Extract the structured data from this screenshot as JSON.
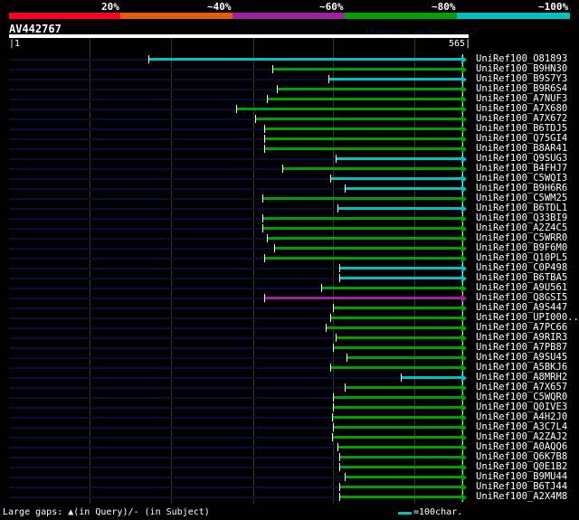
{
  "legend_scale": {
    "labels": [
      "20%",
      "~40%",
      "~60%",
      "~80%",
      "~100%"
    ],
    "colors": [
      "#ff0022",
      "#e06000",
      "#a020a0",
      "#00a000",
      "#00c0c0"
    ]
  },
  "query": {
    "name": "AV442767",
    "start": "1",
    "end": "565",
    "length": 565
  },
  "watermark": "AlignView.pm Beta rel.7",
  "hits": [
    {
      "name": "UniRef100_O81893",
      "start": 174,
      "color": "#00c0c0"
    },
    {
      "name": "UniRef100_B9HN30",
      "start": 329,
      "color": "#00a000"
    },
    {
      "name": "UniRef100_B9S7Y3",
      "start": 398,
      "color": "#00c0c0"
    },
    {
      "name": "UniRef100_B9R6S4",
      "start": 334,
      "color": "#00a000"
    },
    {
      "name": "UniRef100_A7NUF3",
      "start": 322,
      "color": "#00a000"
    },
    {
      "name": "UniRef100_A7X680",
      "start": 283,
      "color": "#00a000"
    },
    {
      "name": "UniRef100_A7X672",
      "start": 307,
      "color": "#00a000"
    },
    {
      "name": "UniRef100_B6TDJ5",
      "start": 319,
      "color": "#00a000"
    },
    {
      "name": "UniRef100_Q75GI4",
      "start": 319,
      "color": "#00a000"
    },
    {
      "name": "UniRef100_B8AR41",
      "start": 319,
      "color": "#00a000"
    },
    {
      "name": "UniRef100_Q9SUG3",
      "start": 407,
      "color": "#00c0c0"
    },
    {
      "name": "UniRef100_B4FHJ7",
      "start": 341,
      "color": "#00a000"
    },
    {
      "name": "UniRef100_C5WQI3",
      "start": 401,
      "color": "#00c0c0"
    },
    {
      "name": "UniRef100_B9H6R6",
      "start": 419,
      "color": "#00c0c0"
    },
    {
      "name": "UniRef100_C5WM25",
      "start": 316,
      "color": "#00a000"
    },
    {
      "name": "UniRef100_B6TDL1",
      "start": 410,
      "color": "#00c0c0"
    },
    {
      "name": "UniRef100_Q33BI9",
      "start": 316,
      "color": "#00a000"
    },
    {
      "name": "UniRef100_A2Z4C5",
      "start": 316,
      "color": "#00a000"
    },
    {
      "name": "UniRef100_C5WRR0",
      "start": 322,
      "color": "#00a000"
    },
    {
      "name": "UniRef100_B9F6M0",
      "start": 331,
      "color": "#00a000"
    },
    {
      "name": "UniRef100_Q10PL5",
      "start": 319,
      "color": "#00a000"
    },
    {
      "name": "UniRef100_C0P498",
      "start": 412,
      "color": "#00c0c0"
    },
    {
      "name": "UniRef100_B6TBA5",
      "start": 412,
      "color": "#00c0c0"
    },
    {
      "name": "UniRef100_A9U561",
      "start": 389,
      "color": "#00a000"
    },
    {
      "name": "UniRef100_Q8GSI5",
      "start": 319,
      "color": "#a020a0"
    },
    {
      "name": "UniRef100_A9S447",
      "start": 404,
      "color": "#00a000"
    },
    {
      "name": "UniRef100_UPI000..",
      "start": 401,
      "color": "#00a000"
    },
    {
      "name": "UniRef100_A7PC66",
      "start": 395,
      "color": "#00a000"
    },
    {
      "name": "UniRef100_A9RIR3",
      "start": 407,
      "color": "#00a000"
    },
    {
      "name": "UniRef100_A7PB87",
      "start": 404,
      "color": "#00a000"
    },
    {
      "name": "UniRef100_A9SU45",
      "start": 421,
      "color": "#00a000"
    },
    {
      "name": "UniRef100_A5BKJ6",
      "start": 401,
      "color": "#00a000"
    },
    {
      "name": "UniRef100_A8MRH2",
      "start": 489,
      "color": "#00c0c0"
    },
    {
      "name": "UniRef100_A7X657",
      "start": 419,
      "color": "#00a000"
    },
    {
      "name": "UniRef100_C5WQR0",
      "start": 404,
      "color": "#00a000"
    },
    {
      "name": "UniRef100_Q0IVE3",
      "start": 404,
      "color": "#00a000"
    },
    {
      "name": "UniRef100_A4H2J0",
      "start": 403,
      "color": "#00a000"
    },
    {
      "name": "UniRef100_A3C7L4",
      "start": 404,
      "color": "#00a000"
    },
    {
      "name": "UniRef100_A2ZAJ2",
      "start": 403,
      "color": "#00a000"
    },
    {
      "name": "UniRef100_A0AQQ6",
      "start": 410,
      "color": "#00a000"
    },
    {
      "name": "UniRef100_Q6K7B8",
      "start": 412,
      "color": "#00a000"
    },
    {
      "name": "UniRef100_Q0E1B2",
      "start": 412,
      "color": "#00a000"
    },
    {
      "name": "UniRef100_B9MU44",
      "start": 419,
      "color": "#00a000"
    },
    {
      "name": "UniRef100_B6TJ44",
      "start": 412,
      "color": "#00a000"
    },
    {
      "name": "UniRef100_A2X4M8",
      "start": 412,
      "color": "#00a000"
    }
  ],
  "footer": {
    "gaps_label": "Large gaps: ▲(in Query)/- (in Subject)",
    "scale_label": "=100char.",
    "scale_color": "#00c0c0"
  }
}
